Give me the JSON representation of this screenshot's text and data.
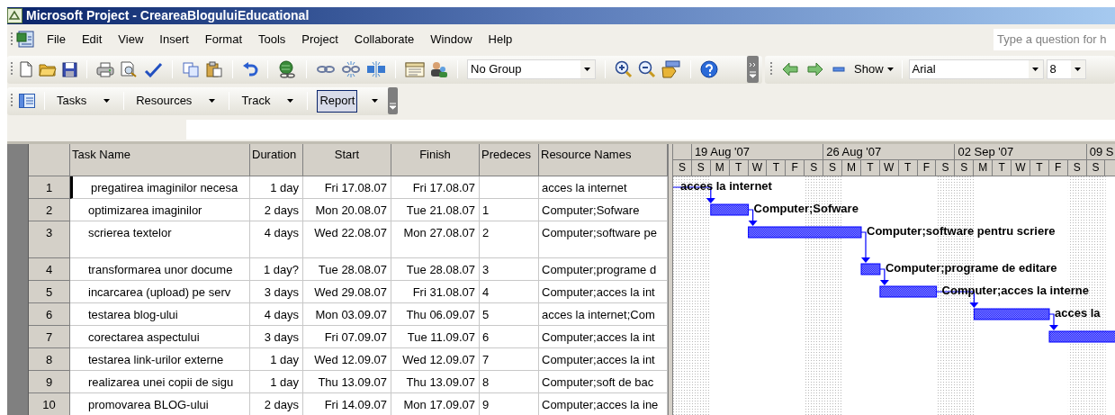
{
  "window": {
    "title": "Microsoft Project - CreareaBloguluiEducational"
  },
  "menu": [
    "File",
    "Edit",
    "View",
    "Insert",
    "Format",
    "Tools",
    "Project",
    "Collaborate",
    "Window",
    "Help"
  ],
  "help_search": {
    "placeholder": "Type a question for h"
  },
  "standard_toolbar": {
    "group": "No Group"
  },
  "formatting_toolbar": {
    "show": "Show",
    "font": "Arial",
    "font_size": "8"
  },
  "guide_toolbar": [
    {
      "label": "Tasks",
      "selected": false
    },
    {
      "label": "Resources",
      "selected": false
    },
    {
      "label": "Track",
      "selected": false
    },
    {
      "label": "Report",
      "selected": true
    }
  ],
  "table": {
    "columns": [
      "Task Name",
      "Duration",
      "Start",
      "Finish",
      "Predeces",
      "Resource Names"
    ],
    "rows": [
      {
        "id": "1",
        "name": "pregatirea imaginilor necesa",
        "duration": "1 day",
        "start": "Fri 17.08.07",
        "finish": "Fri 17.08.07",
        "predecessors": "",
        "resources": "acces la internet",
        "selected": true,
        "tall": false
      },
      {
        "id": "2",
        "name": "optimizarea imaginilor",
        "duration": "2 days",
        "start": "Mon 20.08.07",
        "finish": "Tue 21.08.07",
        "predecessors": "1",
        "resources": "Computer;Sofware",
        "selected": false,
        "tall": false
      },
      {
        "id": "3",
        "name": "scrierea textelor",
        "duration": "4 days",
        "start": "Wed 22.08.07",
        "finish": "Mon 27.08.07",
        "predecessors": "2",
        "resources": "Computer;software pe",
        "selected": false,
        "tall": true
      },
      {
        "id": "4",
        "name": "transformarea unor docume",
        "duration": "1 day?",
        "start": "Tue 28.08.07",
        "finish": "Tue 28.08.07",
        "predecessors": "3",
        "resources": "Computer;programe d",
        "selected": false,
        "tall": false
      },
      {
        "id": "5",
        "name": "incarcarea (upload) pe serv",
        "duration": "3 days",
        "start": "Wed 29.08.07",
        "finish": "Fri 31.08.07",
        "predecessors": "4",
        "resources": "Computer;acces la int",
        "selected": false,
        "tall": false
      },
      {
        "id": "6",
        "name": "testarea blog-ului",
        "duration": "4 days",
        "start": "Mon 03.09.07",
        "finish": "Thu 06.09.07",
        "predecessors": "5",
        "resources": "acces la internet;Com",
        "selected": false,
        "tall": false
      },
      {
        "id": "7",
        "name": "corectarea aspectului",
        "duration": "3 days",
        "start": "Fri 07.09.07",
        "finish": "Tue 11.09.07",
        "predecessors": "6",
        "resources": "Computer;acces la int",
        "selected": false,
        "tall": false
      },
      {
        "id": "8",
        "name": "testarea link-urilor externe",
        "duration": "1 day",
        "start": "Wed 12.09.07",
        "finish": "Wed 12.09.07",
        "predecessors": "7",
        "resources": "Computer;acces la int",
        "selected": false,
        "tall": false
      },
      {
        "id": "9",
        "name": "realizarea unei copii de sigu",
        "duration": "1 day",
        "start": "Thu 13.09.07",
        "finish": "Thu 13.09.07",
        "predecessors": "8",
        "resources": "Computer;soft de bac",
        "selected": false,
        "tall": false
      },
      {
        "id": "10",
        "name": "promovarea BLOG-ului",
        "duration": "2 days",
        "start": "Fri 14.09.07",
        "finish": "Mon 17.09.07",
        "predecessors": "9",
        "resources": "Computer;acces la ine",
        "selected": false,
        "tall": false
      }
    ]
  },
  "gantt": {
    "weeks": [
      "19 Aug '07",
      "26 Aug '07",
      "02 Sep '07",
      "09 S"
    ],
    "days": [
      "S",
      "S",
      "M",
      "T",
      "W",
      "T",
      "F",
      "S",
      "S",
      "M",
      "T",
      "W",
      "T",
      "F",
      "S",
      "S",
      "M",
      "T",
      "W",
      "T",
      "F",
      "S",
      "S"
    ],
    "bar_labels": [
      "acces la internet",
      "Computer;Sofware",
      "Computer;software pentru scriere",
      "Computer;programe de editare",
      "Computer;acces la interne",
      "acces la"
    ]
  }
}
